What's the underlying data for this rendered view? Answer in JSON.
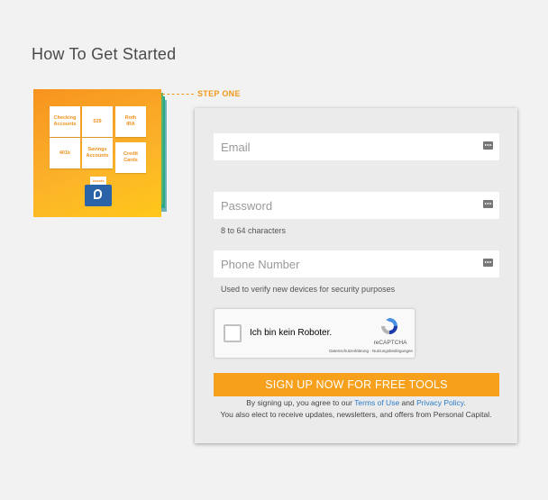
{
  "page": {
    "title": "How To Get Started"
  },
  "step": {
    "label": "STEP ONE"
  },
  "illustration": {
    "tiles": [
      "Checking\nAccounts",
      "529",
      "Roth\nIRA",
      "401k",
      "Savings\nAccounts",
      "Credit\nCards"
    ],
    "folder_label": "Assets",
    "colors": {
      "card_top": "#f7931e",
      "card_bottom": "#ffc81a",
      "folder": "#2a63a8"
    }
  },
  "form": {
    "email": {
      "placeholder": "Email",
      "value": ""
    },
    "password": {
      "placeholder": "Password",
      "value": "",
      "hint": "8 to 64 characters"
    },
    "phone": {
      "placeholder": "Phone Number",
      "value": "",
      "hint": "Used to verify new devices for security purposes"
    },
    "captcha": {
      "label": "Ich bin kein Roboter.",
      "brand": "reCAPTCHA",
      "links": "Datenschutzerklärung - Nutzungsbedingungen"
    },
    "submit_label": "SIGN UP NOW FOR FREE TOOLS",
    "legal": {
      "line1_prefix": "By signing up, you agree to our ",
      "terms_link": "Terms of Use",
      "line1_and": " and ",
      "privacy_link": "Privacy Policy",
      "line1_suffix": ".",
      "line2": "You also elect to receive updates, newsletters, and offers from Personal Capital."
    }
  },
  "colors": {
    "accent": "#f7a01b",
    "link": "#2b7bc7",
    "panel": "#ebebeb"
  }
}
